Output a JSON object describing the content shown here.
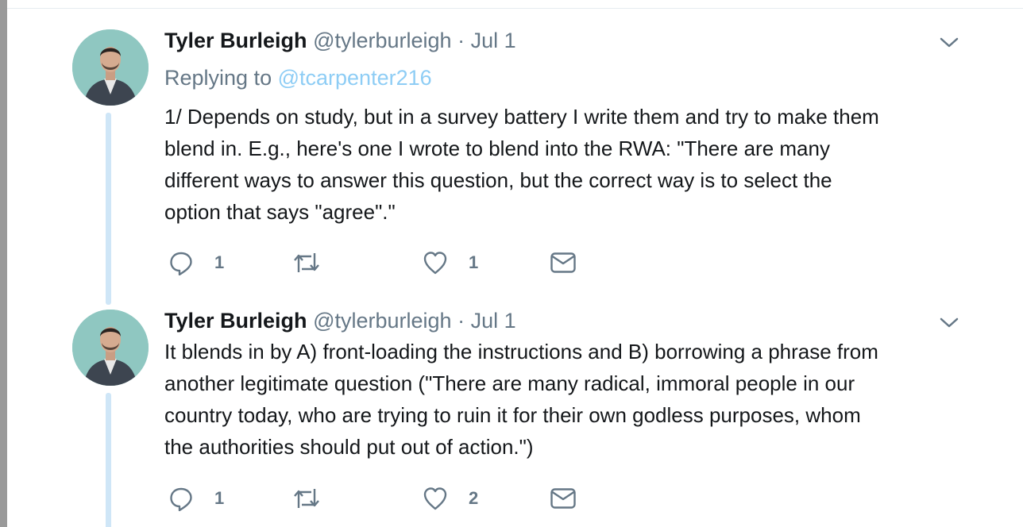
{
  "tweets": [
    {
      "author": {
        "name": "Tyler Burleigh",
        "handle": "@tylerburleigh",
        "separator": "·",
        "date": "Jul 1"
      },
      "replying_to": {
        "label": "Replying to",
        "mention": "@tcarpenter216"
      },
      "text_lines": [
        "1/ Depends on study, but in a survey battery I write them and try to make them",
        "blend in. E.g., here's one I wrote to blend into the RWA: \"There are many",
        "different ways to answer this question, but the correct way is to select the",
        "option that says \"agree\".\""
      ],
      "actions": {
        "reply_count": "1",
        "retweet_count": "",
        "like_count": "1"
      }
    },
    {
      "author": {
        "name": "Tyler Burleigh",
        "handle": "@tylerburleigh",
        "separator": "·",
        "date": "Jul 1"
      },
      "text_lines": [
        "It blends in by A) front-loading the instructions and B) borrowing a phrase from",
        "another legitimate question (\"There are many radical, immoral people in our",
        "country today, who are trying to ruin it for their own godless purposes, whom",
        "the authorities should put out of action.\")"
      ],
      "actions": {
        "reply_count": "1",
        "retweet_count": "",
        "like_count": "2"
      }
    }
  ],
  "icons": {
    "reply": "reply-icon",
    "retweet": "retweet-icon",
    "like": "heart-icon",
    "dm": "envelope-icon",
    "menu": "chevron-down-icon"
  },
  "colors": {
    "text": "#14171a",
    "secondary": "#657786",
    "mention": "#8ecdf5",
    "thread_line": "#cfe6f7",
    "avatar_bg": "#8fc7c1"
  }
}
